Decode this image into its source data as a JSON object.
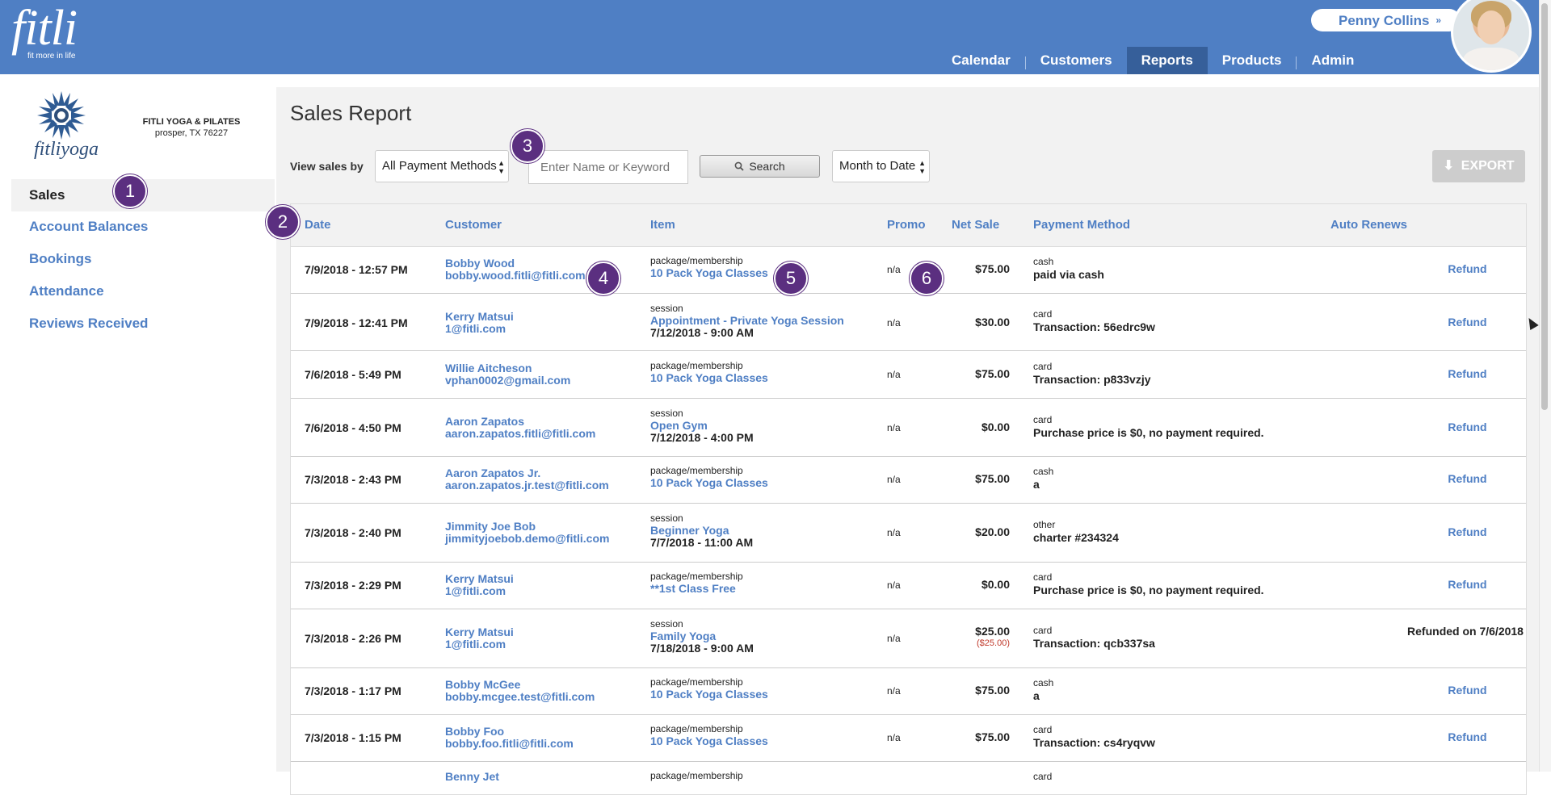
{
  "app": {
    "logo": "fitli",
    "tagline": "fit more in life"
  },
  "nav": {
    "items": [
      "Calendar",
      "Customers",
      "Reports",
      "Products",
      "Admin"
    ],
    "active": "Reports"
  },
  "user": {
    "name": "Penny Collins",
    "chevron": "»"
  },
  "studio": {
    "logo_text": "fitliyoga",
    "name": "FITLI YOGA & PILATES",
    "address": "prosper, TX 76227"
  },
  "sidebar": {
    "items": [
      "Sales",
      "Account Balances",
      "Bookings",
      "Attendance",
      "Reviews Received"
    ],
    "active": "Sales"
  },
  "page": {
    "title": "Sales Report"
  },
  "filters": {
    "view_label": "View sales by",
    "payment_method": "All Payment Methods",
    "search_placeholder": "Enter Name or Keyword",
    "search_label": "Search",
    "period": "Month to Date",
    "export_label": "EXPORT"
  },
  "table": {
    "columns": [
      "Date",
      "Customer",
      "Item",
      "Promo",
      "Net Sale",
      "Payment Method",
      "Auto Renews"
    ],
    "rows": [
      {
        "date": "7/9/2018 - 12:57 PM",
        "customer": "Bobby Wood",
        "email": "bobby.wood.fitli@fitli.com",
        "item_type": "package/membership",
        "item_name": "10 Pack Yoga Classes",
        "item_time": "",
        "promo": "n/a",
        "net": "$75.00",
        "refund_amount": "",
        "pay_type": "cash",
        "pay_detail": "paid via cash",
        "action": "Refund"
      },
      {
        "date": "7/9/2018 - 12:41 PM",
        "customer": "Kerry Matsui",
        "email": "1@fitli.com",
        "item_type": "session",
        "item_name": "Appointment - Private Yoga Session",
        "item_time": "7/12/2018 - 9:00 AM",
        "promo": "n/a",
        "net": "$30.00",
        "refund_amount": "",
        "pay_type": "card",
        "pay_detail": "Transaction: 56edrc9w",
        "action": "Refund"
      },
      {
        "date": "7/6/2018 - 5:49 PM",
        "customer": "Willie Aitcheson",
        "email": "vphan0002@gmail.com",
        "item_type": "package/membership",
        "item_name": "10 Pack Yoga Classes",
        "item_time": "",
        "promo": "n/a",
        "net": "$75.00",
        "refund_amount": "",
        "pay_type": "card",
        "pay_detail": "Transaction: p833vzjy",
        "action": "Refund"
      },
      {
        "date": "7/6/2018 - 4:50 PM",
        "customer": "Aaron Zapatos",
        "email": "aaron.zapatos.fitli@fitli.com",
        "item_type": "session",
        "item_name": "Open Gym",
        "item_time": "7/12/2018 - 4:00 PM",
        "promo": "n/a",
        "net": "$0.00",
        "refund_amount": "",
        "pay_type": "card",
        "pay_detail": "Purchase price is $0, no payment required.",
        "action": "Refund"
      },
      {
        "date": "7/3/2018 - 2:43 PM",
        "customer": "Aaron Zapatos Jr.",
        "email": "aaron.zapatos.jr.test@fitli.com",
        "item_type": "package/membership",
        "item_name": "10 Pack Yoga Classes",
        "item_time": "",
        "promo": "n/a",
        "net": "$75.00",
        "refund_amount": "",
        "pay_type": "cash",
        "pay_detail": "a",
        "action": "Refund"
      },
      {
        "date": "7/3/2018 - 2:40 PM",
        "customer": "Jimmity Joe Bob",
        "email": "jimmityjoebob.demo@fitli.com",
        "item_type": "session",
        "item_name": "Beginner Yoga",
        "item_time": "7/7/2018 - 11:00 AM",
        "promo": "n/a",
        "net": "$20.00",
        "refund_amount": "",
        "pay_type": "other",
        "pay_detail": "charter #234324",
        "action": "Refund"
      },
      {
        "date": "7/3/2018 - 2:29 PM",
        "customer": "Kerry Matsui",
        "email": "1@fitli.com",
        "item_type": "package/membership",
        "item_name": "**1st Class Free",
        "item_time": "",
        "promo": "n/a",
        "net": "$0.00",
        "refund_amount": "",
        "pay_type": "card",
        "pay_detail": "Purchase price is $0, no payment required.",
        "action": "Refund"
      },
      {
        "date": "7/3/2018 - 2:26 PM",
        "customer": "Kerry Matsui",
        "email": "1@fitli.com",
        "item_type": "session",
        "item_name": "Family Yoga",
        "item_time": "7/18/2018 - 9:00 AM",
        "promo": "n/a",
        "net": "$25.00",
        "refund_amount": "($25.00)",
        "pay_type": "card",
        "pay_detail": "Transaction: qcb337sa",
        "action": "Refunded on 7/6/2018"
      },
      {
        "date": "7/3/2018 - 1:17 PM",
        "customer": "Bobby McGee",
        "email": "bobby.mcgee.test@fitli.com",
        "item_type": "package/membership",
        "item_name": "10 Pack Yoga Classes",
        "item_time": "",
        "promo": "n/a",
        "net": "$75.00",
        "refund_amount": "",
        "pay_type": "cash",
        "pay_detail": "a",
        "action": "Refund"
      },
      {
        "date": "7/3/2018 - 1:15 PM",
        "customer": "Bobby Foo",
        "email": "bobby.foo.fitli@fitli.com",
        "item_type": "package/membership",
        "item_name": "10 Pack Yoga Classes",
        "item_time": "",
        "promo": "n/a",
        "net": "$75.00",
        "refund_amount": "",
        "pay_type": "card",
        "pay_detail": "Transaction: cs4ryqvw",
        "action": "Refund"
      },
      {
        "date": "",
        "customer": "Benny Jet",
        "email": "",
        "item_type": "package/membership",
        "item_name": "",
        "item_time": "",
        "promo": "",
        "net": "",
        "refund_amount": "",
        "pay_type": "card",
        "pay_detail": "",
        "action": ""
      }
    ]
  },
  "badges": [
    "1",
    "2",
    "3",
    "4",
    "5",
    "6"
  ],
  "colors": {
    "header": "#4f7fc4",
    "active_nav": "#365f9a",
    "link": "#4f7fc4",
    "badge": "#5b2f80",
    "refund_negative": "#c0392b"
  }
}
